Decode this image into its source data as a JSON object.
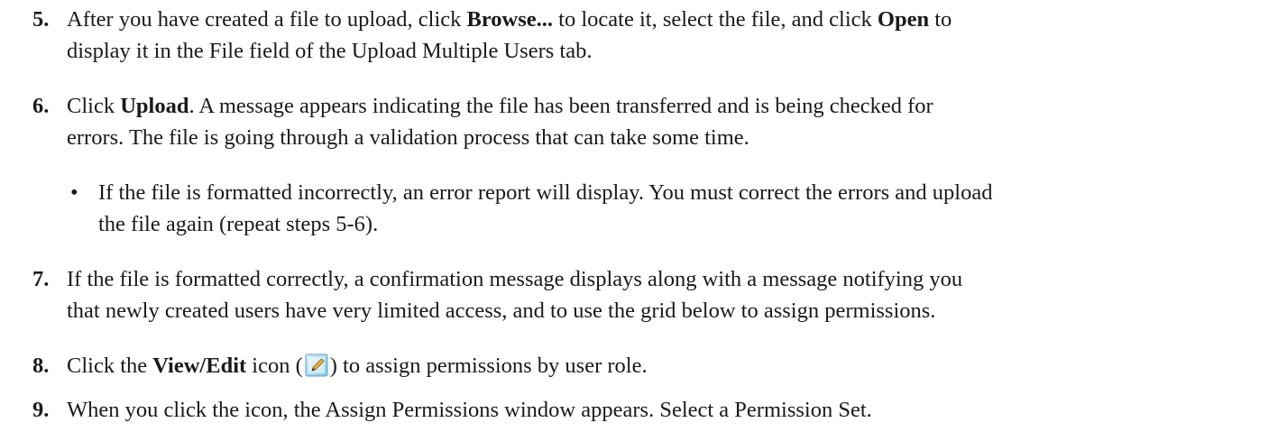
{
  "steps": {
    "s5": {
      "number": "5.",
      "line1": {
        "a": "After you have created a file to upload, click ",
        "b": "Browse...",
        "c": " to locate it, select the file, and click ",
        "d": "Open",
        "e": " to"
      },
      "line2": "display it in the File field of the Upload Multiple Users tab."
    },
    "s6": {
      "number": "6.",
      "line1": {
        "a": "Click ",
        "b": "Upload",
        "c": ". A message appears indicating the file has been transferred and is being checked for"
      },
      "line2": "errors. The file is going through a validation process that can take some time."
    },
    "bullet": {
      "symbol": "•",
      "line1": "If the file is formatted incorrectly, an error report will display. You must correct the errors and upload",
      "line2": "the file again (repeat steps 5-6)."
    },
    "s7": {
      "number": "7.",
      "line1": "If the file is formatted correctly, a confirmation message displays along with a message notifying you",
      "line2": "that newly created users have very limited access, and to use the grid below to assign permissions."
    },
    "s8": {
      "number": "8.",
      "a": "Click the ",
      "b": "View/Edit",
      "c": " icon (",
      "icon": "view-edit-icon",
      "d": ") to assign permissions by user role."
    },
    "s9": {
      "number": "9.",
      "line1": "When you click the icon, the Assign Permissions window appears. Select a Permission Set."
    }
  }
}
